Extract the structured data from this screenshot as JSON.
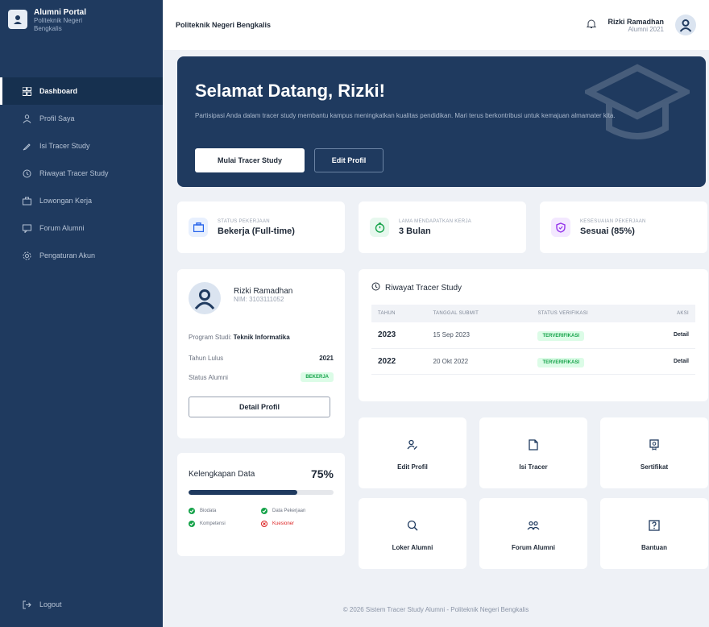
{
  "sidebar": {
    "brand_title": "Alumni Portal",
    "brand_subtitle": "Politeknik Negeri Bengkalis",
    "items": [
      {
        "label": "Dashboard",
        "icon": "dashboard-icon",
        "active": true
      },
      {
        "label": "Profil Saya",
        "icon": "user-icon"
      },
      {
        "label": "Isi Tracer Study",
        "icon": "edit-icon"
      },
      {
        "label": "Riwayat Tracer Study",
        "icon": "history-icon"
      },
      {
        "label": "Lowongan Kerja",
        "icon": "briefcase-icon"
      },
      {
        "label": "Forum Alumni",
        "icon": "chat-icon"
      },
      {
        "label": "Pengaturan Akun",
        "icon": "settings-icon"
      }
    ],
    "logout": "Logout"
  },
  "topbar": {
    "institution": "Politeknik Negeri Bengkalis",
    "user_name": "Rizki Ramadhan",
    "user_sub": "Alumni 2021"
  },
  "hero": {
    "title": "Selamat Datang, Rizki!",
    "text": "Partisipasi Anda dalam tracer study membantu kampus meningkatkan kualitas pendidikan. Mari terus berkontribusi untuk kemajuan almamater kita.",
    "primary_btn": "Mulai Tracer Study",
    "secondary_btn": "Edit Profil"
  },
  "stats": [
    {
      "label": "STATUS PEKERJAAN",
      "value": "Bekerja (Full-time)",
      "icon": "briefcase-icon",
      "color": "#2563eb",
      "bg": "#e8f0fe"
    },
    {
      "label": "LAMA MENDAPATKAN KERJA",
      "value": "3 Bulan",
      "icon": "clock-icon",
      "color": "#16a34a",
      "bg": "#e7f8ee"
    },
    {
      "label": "KESESUAIAN PEKERJAAN",
      "value": "Sesuai (85%)",
      "icon": "shield-icon",
      "color": "#9333ea",
      "bg": "#f3e8ff"
    }
  ],
  "profile": {
    "name": "Rizki Ramadhan",
    "nim": "NIM: 3103111052",
    "prodi_label": "Program Studi",
    "prodi_value": "Teknik Informatika",
    "year_label": "Tahun Lulus",
    "year_value": "2021",
    "status_label": "Status Alumni",
    "status_value": "BEKERJA",
    "detail_btn": "Detail Profil"
  },
  "history": {
    "title": "Riwayat Tracer Study",
    "columns": [
      "TAHUN",
      "TANGGAL SUBMIT",
      "STATUS VERIFIKASI",
      "AKSI"
    ],
    "rows": [
      {
        "year": "2023",
        "date": "15 Sep 2023",
        "status": "TERVERIFIKASI",
        "action": "Detail"
      },
      {
        "year": "2022",
        "date": "20 Okt 2022",
        "status": "TERVERIFIKASI",
        "action": "Detail"
      }
    ]
  },
  "completeness": {
    "title": "Kelengkapan Data",
    "percent_label": "75%",
    "percent": 75,
    "items": [
      {
        "label": "Biodata",
        "done": true
      },
      {
        "label": "Data Pekerjaan",
        "done": true
      },
      {
        "label": "Kompetensi",
        "done": true
      },
      {
        "label": "Kuesioner",
        "done": false
      }
    ]
  },
  "quick_actions": [
    {
      "label": "Edit Profil",
      "icon": "user-edit-icon"
    },
    {
      "label": "Isi Tracer",
      "icon": "document-icon"
    },
    {
      "label": "Sertifikat",
      "icon": "certificate-icon"
    },
    {
      "label": "Loker Alumni",
      "icon": "search-job-icon"
    },
    {
      "label": "Forum Alumni",
      "icon": "people-icon"
    },
    {
      "label": "Bantuan",
      "icon": "help-icon"
    }
  ],
  "footer": "© 2026 Sistem Tracer Study Alumni - Politeknik Negeri Bengkalis"
}
